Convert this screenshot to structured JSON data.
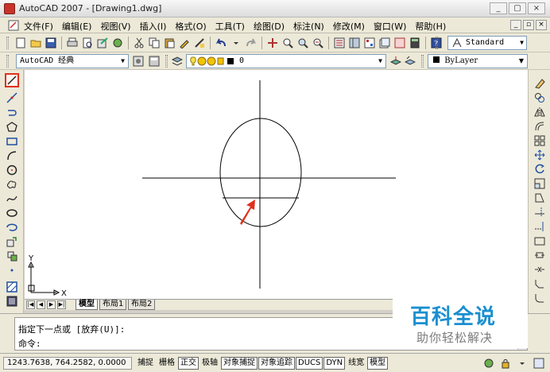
{
  "window": {
    "title": "AutoCAD 2007 - [Drawing1.dwg]",
    "minimize": "_",
    "maximize": "▢",
    "close": "×"
  },
  "menu": {
    "items": [
      "文件(F)",
      "编辑(E)",
      "视图(V)",
      "插入(I)",
      "格式(O)",
      "工具(T)",
      "绘图(D)",
      "标注(N)",
      "修改(M)",
      "窗口(W)",
      "帮助(H)"
    ],
    "mdi_min": "_",
    "mdi_restore": "▫",
    "mdi_close": "×"
  },
  "toolbar": {
    "text_style": "Standard",
    "workspace": "AutoCAD 经典",
    "layer": "0",
    "color": "ByLayer"
  },
  "draw_tools": [
    "line",
    "construction-line",
    "polyline",
    "polygon",
    "rectangle",
    "arc",
    "circle",
    "revision-cloud",
    "spline",
    "ellipse",
    "ellipse-arc",
    "insert-block",
    "make-block",
    "point",
    "hatch",
    "gradient"
  ],
  "modify_tools": [
    "erase",
    "copy",
    "mirror",
    "offset",
    "array",
    "move",
    "rotate",
    "scale",
    "stretch",
    "trim",
    "extend",
    "break-at-point",
    "break",
    "join",
    "chamfer",
    "fillet"
  ],
  "ucs": {
    "x": "X",
    "y": "Y"
  },
  "layout_tabs": [
    "模型",
    "布局1",
    "布局2"
  ],
  "command": {
    "line1": "指定下一点或 [放弃(U)]:",
    "line2": "命令:"
  },
  "status": {
    "coords": "1243.7638, 764.2582, 0.0000",
    "toggles": [
      {
        "label": "捕捉",
        "on": false
      },
      {
        "label": "栅格",
        "on": false
      },
      {
        "label": "正交",
        "on": true
      },
      {
        "label": "极轴",
        "on": false
      },
      {
        "label": "对象捕捉",
        "on": true
      },
      {
        "label": "对象追踪",
        "on": true
      },
      {
        "label": "DUCS",
        "on": true
      },
      {
        "label": "DYN",
        "on": true
      },
      {
        "label": "线宽",
        "on": false
      },
      {
        "label": "模型",
        "on": true
      }
    ]
  },
  "watermark": {
    "title": "百科全说",
    "subtitle": "助你轻松解决"
  },
  "colors": {
    "accent_red": "#e0301e",
    "watermark_blue": "#1a8fd0"
  }
}
